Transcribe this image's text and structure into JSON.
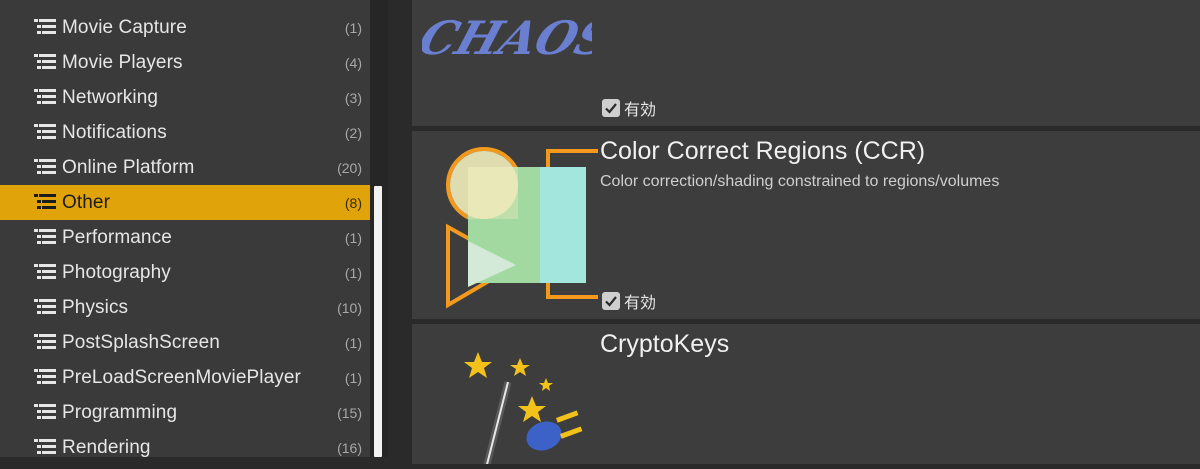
{
  "sidebar": {
    "items": [
      {
        "label": "Movie Capture",
        "count": "(1)",
        "selected": false
      },
      {
        "label": "Movie Players",
        "count": "(4)",
        "selected": false
      },
      {
        "label": "Networking",
        "count": "(3)",
        "selected": false
      },
      {
        "label": "Notifications",
        "count": "(2)",
        "selected": false
      },
      {
        "label": "Online Platform",
        "count": "(20)",
        "selected": false
      },
      {
        "label": "Other",
        "count": "(8)",
        "selected": true
      },
      {
        "label": "Performance",
        "count": "(1)",
        "selected": false
      },
      {
        "label": "Photography",
        "count": "(1)",
        "selected": false
      },
      {
        "label": "Physics",
        "count": "(10)",
        "selected": false
      },
      {
        "label": "PostSplashScreen",
        "count": "(1)",
        "selected": false
      },
      {
        "label": "PreLoadScreenMoviePlayer",
        "count": "(1)",
        "selected": false
      },
      {
        "label": "Programming",
        "count": "(15)",
        "selected": false
      },
      {
        "label": "Rendering",
        "count": "(16)",
        "selected": false
      }
    ]
  },
  "plugins": [
    {
      "title": "",
      "description": "",
      "enabled_label": "有効",
      "enabled": true,
      "logo_text": "CHAOS"
    },
    {
      "title": "Color Correct Regions (CCR)",
      "description": "Color correction/shading constrained to regions/volumes",
      "enabled_label": "有効",
      "enabled": true
    },
    {
      "title": "CryptoKeys",
      "description": "",
      "enabled_label": "",
      "enabled": false
    }
  ],
  "colors": {
    "selected_row": "#e0a30a",
    "accent_orange": "#f39a1e"
  }
}
